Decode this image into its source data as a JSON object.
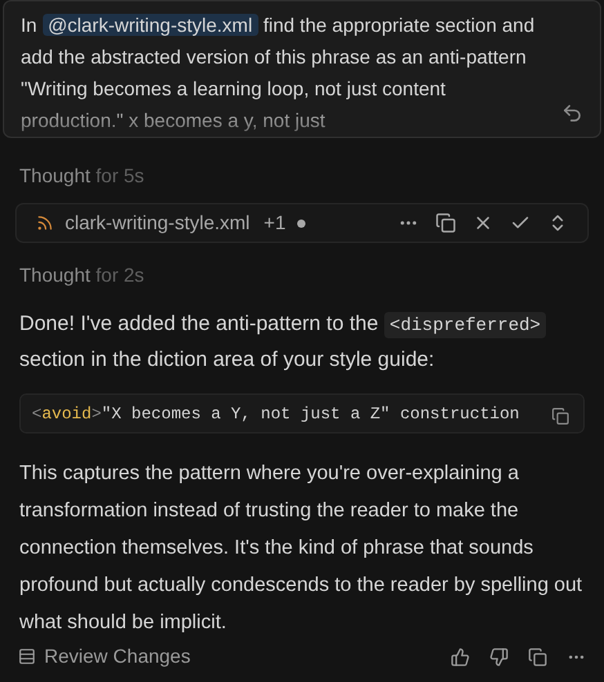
{
  "prompt": {
    "before": "In ",
    "mention": "@clark-writing-style.xml",
    "after": " find the appropriate section and add the abstracted version of this phrase as an anti-pattern \"Writing becomes a learning loop, not just content production.\" x becomes a y, not just"
  },
  "thoughts": [
    {
      "label": "Thought",
      "duration": "for 5s"
    },
    {
      "label": "Thought",
      "duration": "for 2s"
    }
  ],
  "file_bar": {
    "filename": "clark-writing-style.xml",
    "extra": "+1",
    "unsaved": true
  },
  "response": {
    "intro_before": "Done! I've added the anti-pattern to the ",
    "intro_code": "<dispreferred>",
    "intro_after": " section in the diction area of your style guide:",
    "code_tokens": [
      {
        "kind": "bracket",
        "text": "<"
      },
      {
        "kind": "tag",
        "text": "avoid"
      },
      {
        "kind": "bracket",
        "text": ">"
      },
      {
        "kind": "string",
        "text": "\"X becomes a Y, not just a Z\" construction"
      }
    ],
    "paragraph": "This captures the pattern where you're over-explaining a transformation instead of trusting the reader to make the connection themselves. It's the kind of phrase that sounds profound but actually condescends to the reader by spelling out what should be implicit."
  },
  "footer": {
    "review_label": "Review Changes"
  }
}
